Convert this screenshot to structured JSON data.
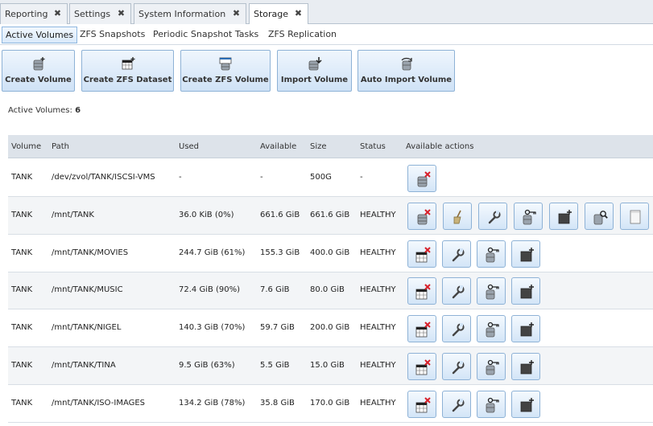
{
  "tabs": [
    {
      "label": "Reporting"
    },
    {
      "label": "Settings"
    },
    {
      "label": "System Information"
    },
    {
      "label": "Storage"
    }
  ],
  "tab_close_glyph": "✖",
  "subtabs": [
    {
      "label": "Active Volumes"
    },
    {
      "label": "ZFS Snapshots"
    },
    {
      "label": "Periodic Snapshot Tasks"
    },
    {
      "label": "ZFS Replication"
    }
  ],
  "toolbar": [
    {
      "label": "Create Volume",
      "icon": "create-volume-icon"
    },
    {
      "label": "Create ZFS Dataset",
      "icon": "create-dataset-icon"
    },
    {
      "label": "Create ZFS Volume",
      "icon": "create-zvol-icon"
    },
    {
      "label": "Import Volume",
      "icon": "import-volume-icon"
    },
    {
      "label": "Auto Import Volume",
      "icon": "auto-import-icon"
    }
  ],
  "summary": {
    "label": "Active Volumes:",
    "count": "6"
  },
  "table": {
    "columns": [
      "Volume",
      "Path",
      "Used",
      "Available",
      "Size",
      "Status",
      "Available actions"
    ],
    "rows": [
      {
        "volume": "TANK",
        "path": "/dev/zvol/TANK/ISCSI-VMS",
        "used": "-",
        "available": "-",
        "size": "500G",
        "status": "-",
        "actions": [
          "delete-zvol-icon"
        ]
      },
      {
        "volume": "TANK",
        "path": "/mnt/TANK",
        "used": "36.0 KiB (0%)",
        "available": "661.6 GiB",
        "size": "661.6 GiB",
        "status": "HEALTHY",
        "actions": [
          "detach-volume-icon",
          "scrub-broom-icon",
          "wrench-icon",
          "permissions-key-icon",
          "create-dataset-icon",
          "volume-status-magnifier-icon",
          "blank-page-icon"
        ]
      },
      {
        "volume": "TANK",
        "path": "/mnt/TANK/MOVIES",
        "used": "244.7 GiB (61%)",
        "available": "155.3 GiB",
        "size": "400.0 GiB",
        "status": "HEALTHY",
        "actions": [
          "delete-dataset-icon",
          "wrench-icon",
          "permissions-key-icon",
          "create-dataset-icon"
        ]
      },
      {
        "volume": "TANK",
        "path": "/mnt/TANK/MUSIC",
        "used": "72.4 GiB (90%)",
        "available": "7.6 GiB",
        "size": "80.0 GiB",
        "status": "HEALTHY",
        "actions": [
          "delete-dataset-icon",
          "wrench-icon",
          "permissions-key-icon",
          "create-dataset-icon"
        ]
      },
      {
        "volume": "TANK",
        "path": "/mnt/TANK/NIGEL",
        "used": "140.3 GiB (70%)",
        "available": "59.7 GiB",
        "size": "200.0 GiB",
        "status": "HEALTHY",
        "actions": [
          "delete-dataset-icon",
          "wrench-icon",
          "permissions-key-icon",
          "create-dataset-icon"
        ]
      },
      {
        "volume": "TANK",
        "path": "/mnt/TANK/TINA",
        "used": "9.5 GiB (63%)",
        "available": "5.5 GiB",
        "size": "15.0 GiB",
        "status": "HEALTHY",
        "actions": [
          "delete-dataset-icon",
          "wrench-icon",
          "permissions-key-icon",
          "create-dataset-icon"
        ]
      },
      {
        "volume": "TANK",
        "path": "/mnt/TANK/ISO-IMAGES",
        "used": "134.2 GiB (78%)",
        "available": "35.8 GiB",
        "size": "170.0 GiB",
        "status": "HEALTHY",
        "actions": [
          "delete-dataset-icon",
          "wrench-icon",
          "permissions-key-icon",
          "create-dataset-icon"
        ]
      }
    ]
  },
  "colors": {
    "accent": "#8eb2d6",
    "header_bg": "#dde3ea",
    "delete_red": "#d8202a"
  }
}
